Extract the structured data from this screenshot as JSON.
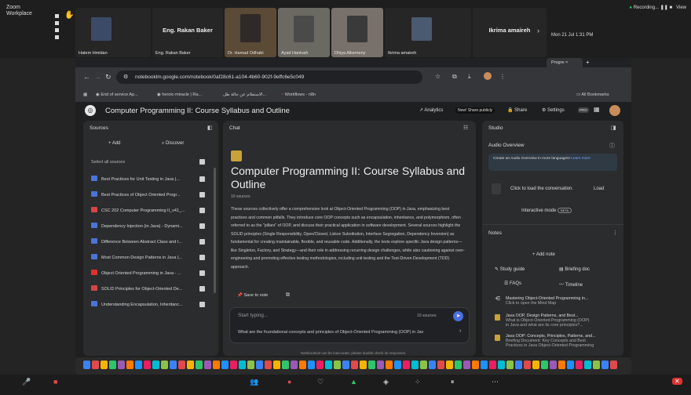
{
  "zoom": {
    "app_name": "Zoom",
    "app_sub": "Workplace",
    "recording": "Recording...",
    "view": "View",
    "participants": [
      {
        "name": "Hatem Hmidan"
      },
      {
        "name": "Eng. Rakan Baker",
        "label": "Eng. Rakan Baker"
      },
      {
        "name": "Dr. Hamad Odhabi"
      },
      {
        "name": "Ayad Hantush"
      },
      {
        "name": "Dhiya Alkemeny"
      },
      {
        "name": "Ikrima amaireh",
        "label": "Ikrima amaireh"
      }
    ],
    "next": "›"
  },
  "mac": {
    "date": "Mon 21 Jul 1:31 PM"
  },
  "browser": {
    "tab": "Progre",
    "tab_close": "×",
    "new_tab": "+",
    "url": "notebooklm.google.com/notebook/0af28c61-a104-4b60-902f-9effc6e5c049",
    "bookmarks": [
      "End of service Ap...",
      "heroic-miracle | Ra...",
      "الاستعلام عن حالة طل...",
      "Workflows - n8n"
    ],
    "all_bookmarks": "All Bookmarks"
  },
  "app": {
    "title": "Computer Programming II: Course Syllabus and Outline",
    "analytics": "Analytics",
    "share_publicly": "New! Share publicly",
    "share": "Share",
    "settings": "Settings",
    "pro": "PRO",
    "footer": "NotebookLM can be inaccurate; please double check its responses."
  },
  "sources": {
    "title": "Sources",
    "add": "+ Add",
    "discover": "Discover",
    "select_all": "Select all sources",
    "items": [
      {
        "label": "Best Practices for Unit Testing in Java |...",
        "color": "#4a74d8"
      },
      {
        "label": "Best Practices of Object Oriented Progr...",
        "color": "#4a74d8"
      },
      {
        "label": "CSC 202 Computer Programming II_v41_...",
        "color": "#d64545"
      },
      {
        "label": "Dependency Injection (in Java) - Dynami...",
        "color": "#4a74d8"
      },
      {
        "label": "Difference Between Abstract Class and I...",
        "color": "#4a74d8"
      },
      {
        "label": "Most Common Design Patterns in Java (...",
        "color": "#4a74d8"
      },
      {
        "label": "Object Oriented Programming in Java - ...",
        "color": "#e0312c"
      },
      {
        "label": "SOLID Principles for Object-Oriented De...",
        "color": "#d64545"
      },
      {
        "label": "Understanding Encapsulation, Inheritanc...",
        "color": "#4a74d8"
      }
    ]
  },
  "chat": {
    "title": "Chat",
    "heading": "Computer Programming II: Course Syllabus and Outline",
    "count": "10 sources",
    "summary": "These sources collectively offer a comprehensive look at Object-Oriented Programming (OOP) in Java, emphasizing best practices and common pitfalls. They introduce core OOP concepts such as encapsulation, inheritance, and polymorphism, often referred to as the \"pillars\" of OOP, and discuss their practical application in software development. Several sources highlight the SOLID principles (Single Responsibility, Open/Closed, Liskov Substitution, Interface Segregation, Dependency Inversion) as fundamental for creating maintainable, flexible, and reusable code. Additionally, the texts explore specific Java design patterns—like Singleton, Factory, and Strategy—and their role in addressing recurring design challenges, while also cautioning against over-engineering and promoting effective testing methodologies, including unit testing and the Test-Driven Development (TDD) approach.",
    "save_note": "Save to note",
    "placeholder": "Start typing...",
    "src_count": "10 sources",
    "suggestion": "What are the foundational concepts and principles of Object-Oriented Programming (OOP) in Jav"
  },
  "studio": {
    "title": "Studio",
    "audio_title": "Audio Overview",
    "audio_banner": "Create an Audio Overview in more languages!",
    "learn_more": "Learn more",
    "click_load": "Click to load the conversation.",
    "load": "Load",
    "interactive": "Interactive mode",
    "beta": "BETA",
    "notes_title": "Notes",
    "add_note": "+ Add note",
    "study_guide": "Study guide",
    "briefing": "Briefing doc",
    "faqs": "FAQs",
    "timeline": "Timeline",
    "notes": [
      {
        "t1": "Mastering Object-Oriented Programming in...",
        "t2": "Click to open the Mind Map"
      },
      {
        "t1": "Java OOP, Design Patterns, and Best...",
        "t2": "What is Object-Oriented Programming (OOP)",
        "t3": "in Java and what are its core principles?..."
      },
      {
        "t1": "Java OOP: Concepts, Principles, Patterns, and...",
        "t2": "Briefing Document: Key Concepts and Best",
        "t3": "Practices in Java Object-Oriented Programming"
      }
    ]
  }
}
